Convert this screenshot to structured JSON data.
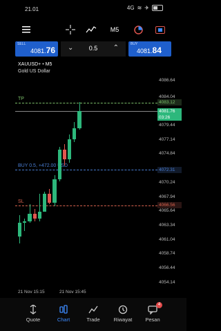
{
  "status": {
    "time": "21.01",
    "signal": "4G",
    "battery_icon": "battery-icon"
  },
  "trade": {
    "sell_label": "SELL",
    "sell_price_main": "4081.",
    "sell_price_big": "76",
    "buy_label": "BUY",
    "buy_price_main": "4081.",
    "buy_price_big": "84",
    "volume": "0.5"
  },
  "symbol": {
    "name": "XAUUSD+",
    "timeframe": "M5",
    "description": "Gold US Dollar"
  },
  "toolbar": {
    "timeframe_label": "M5"
  },
  "chart_data": {
    "type": "candlestick",
    "price_labels": [
      "4086.64",
      "4084.04",
      "4081.76",
      "4079.44",
      "4077.14",
      "4074.84",
      "4072.31",
      "4070.24",
      "4067.94",
      "4066.56",
      "4065.64",
      "4063.34",
      "4061.04",
      "4058.74",
      "4056.44",
      "4054.14"
    ],
    "tp_label": "TP",
    "tp_price": "4083.12",
    "bid_price": "4081.76",
    "countdown": "03:26",
    "position_label": "BUY 0.5, +472.00 USD",
    "position_price": "4072.31",
    "sl_label": "SL",
    "sl_price": "4066.56",
    "x_labels": [
      "21 Nov 15:15",
      "21 Nov 15:45"
    ],
    "ylim": [
      4053.0,
      4089.0
    ],
    "candles": [
      {
        "o": 4061.5,
        "h": 4065.0,
        "l": 4060.5,
        "c": 4063.8
      },
      {
        "o": 4063.8,
        "h": 4064.5,
        "l": 4062.5,
        "c": 4064.0
      },
      {
        "o": 4064.0,
        "h": 4066.8,
        "l": 4063.8,
        "c": 4065.2
      },
      {
        "o": 4065.2,
        "h": 4066.0,
        "l": 4064.0,
        "c": 4064.4
      },
      {
        "o": 4064.4,
        "h": 4068.5,
        "l": 4064.0,
        "c": 4065.6
      },
      {
        "o": 4065.6,
        "h": 4068.8,
        "l": 4065.5,
        "c": 4068.4
      },
      {
        "o": 4068.4,
        "h": 4069.2,
        "l": 4066.8,
        "c": 4067.0
      },
      {
        "o": 4067.0,
        "h": 4071.5,
        "l": 4066.5,
        "c": 4070.8
      },
      {
        "o": 4070.8,
        "h": 4076.0,
        "l": 4070.5,
        "c": 4075.6
      },
      {
        "o": 4075.6,
        "h": 4076.4,
        "l": 4073.0,
        "c": 4074.0
      },
      {
        "o": 4074.0,
        "h": 4078.0,
        "l": 4073.5,
        "c": 4077.2
      },
      {
        "o": 4077.2,
        "h": 4080.0,
        "l": 4076.8,
        "c": 4079.0
      },
      {
        "o": 4079.0,
        "h": 4083.2,
        "l": 4078.8,
        "c": 4081.76
      }
    ]
  },
  "nav": [
    {
      "label": "Quote",
      "icon": "quote-icon"
    },
    {
      "label": "Chart",
      "icon": "chart-icon"
    },
    {
      "label": "Trade",
      "icon": "trade-icon"
    },
    {
      "label": "Riwayat",
      "icon": "history-icon"
    },
    {
      "label": "Pesan",
      "icon": "message-icon",
      "badge": "4"
    }
  ],
  "colors": {
    "accent": "#1f5fcc",
    "bull": "#2db87c",
    "bear": "#e0564f",
    "tp": "#7bbf6a",
    "sl": "#d9634f",
    "position": "#4a7fd6"
  }
}
